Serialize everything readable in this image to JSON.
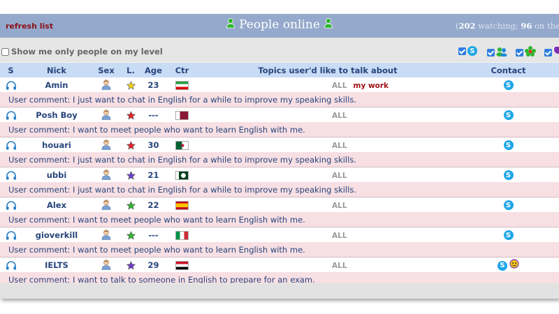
{
  "header": {
    "refresh_label": "refresh list",
    "title": "People online",
    "watching_open": "(",
    "watching_count": "202",
    "watching_label": " watching; ",
    "level_count": "96",
    "level_label": " on the lis"
  },
  "options": {
    "level_only_label": "Show me only people on my level"
  },
  "table": {
    "headers": {
      "s": "S",
      "nick": "Nick",
      "sex": "Sex",
      "level": "L.",
      "age": "Age",
      "country": "Ctr",
      "topics": "Topics user'd like to talk about",
      "contact": "Contact"
    },
    "comment_prefix": "User comment:",
    "rows": [
      {
        "nick": "Amin",
        "age": "23",
        "topic": "ALL",
        "extra_topic": "my work",
        "comment": "I just want to chat in English for a while to improve my speaking skills.",
        "star_color": "#f2d21a",
        "flag": "iran"
      },
      {
        "nick": "Posh Boy",
        "age": "---",
        "topic": "ALL",
        "extra_topic": "",
        "comment": "I want to meet people who want to learn English with me.",
        "star_color": "#e0242b",
        "flag": "qatar"
      },
      {
        "nick": "houari",
        "age": "30",
        "topic": "ALL",
        "extra_topic": "",
        "comment": "I just want to chat in English for a while to improve my speaking skills.",
        "star_color": "#e0242b",
        "flag": "algeria"
      },
      {
        "nick": "ubbi",
        "age": "21",
        "topic": "ALL",
        "extra_topic": "",
        "comment": "I just want to chat in English for a while to improve my speaking skills.",
        "star_color": "#6a3ec8",
        "flag": "pakistan"
      },
      {
        "nick": "Alex",
        "age": "22",
        "topic": "ALL",
        "extra_topic": "",
        "comment": "I want to meet people who want to learn English with me.",
        "star_color": "#2fb52f",
        "flag": "spain"
      },
      {
        "nick": "gioverkill",
        "age": "---",
        "topic": "ALL",
        "extra_topic": "",
        "comment": "I want to meet people who want to learn English with me.",
        "star_color": "#2fb52f",
        "flag": "italy"
      },
      {
        "nick": "IELTS",
        "age": "29",
        "topic": "ALL",
        "extra_topic": "",
        "comment": "I want to talk to someone in English to prepare for an exam.",
        "star_color": "#6a3ec8",
        "flag": "egypt"
      }
    ]
  },
  "icons": {
    "headphones": "headphones-icon",
    "user": "user-icon",
    "star": "level-star-icon",
    "skype": "skype-icon"
  }
}
